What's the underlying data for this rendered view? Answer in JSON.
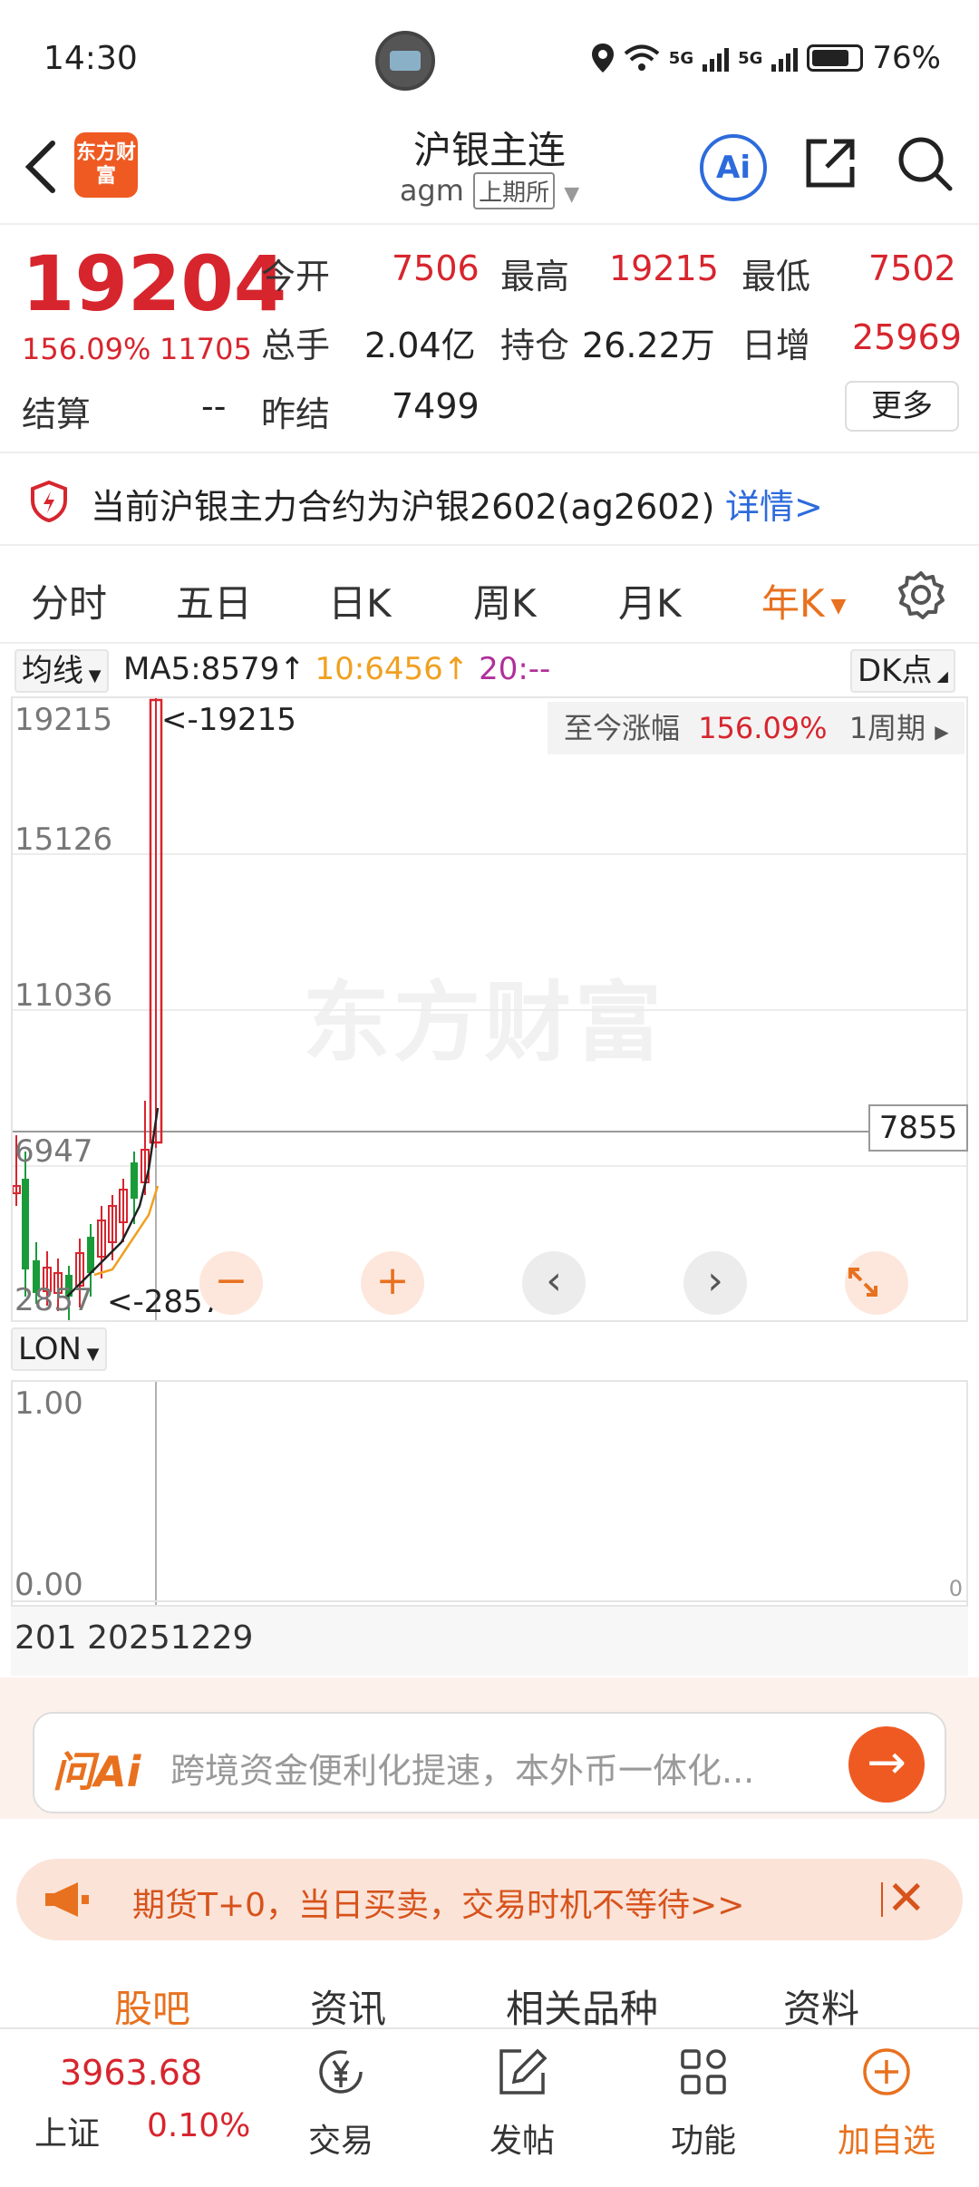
{
  "status": {
    "time": "14:30",
    "net1": "5G",
    "net2": "5G",
    "battery": "76%"
  },
  "header": {
    "logo_text": "东方财富",
    "title": "沪银主连",
    "code": "agm",
    "exchange": "上期所",
    "ai_label": "Ai"
  },
  "quote": {
    "price": "19204",
    "change_pct": "156.09%",
    "change_abs": "11705",
    "open_label": "今开",
    "open": "7506",
    "high_label": "最高",
    "high": "19215",
    "low_label": "最低",
    "low": "7502",
    "volume_label": "总手",
    "volume": "2.04亿",
    "position_label": "持仓",
    "position": "26.22万",
    "daily_inc_label": "日增",
    "daily_inc": "25969",
    "settle_label": "结算",
    "settle": "--",
    "prev_settle_label": "昨结",
    "prev_settle": "7499",
    "more_label": "更多"
  },
  "notice": {
    "text": "当前沪银主力合约为沪银2602(ag2602)",
    "link": "详情>"
  },
  "period_tabs": [
    "分时",
    "五日",
    "日K",
    "周K",
    "月K",
    "年K"
  ],
  "active_tab": "年K",
  "indicator": {
    "selector": "均线",
    "ma5": "MA5:8579↑",
    "ma10": "10:6456↑",
    "ma20": "20:--",
    "dk": "DK点"
  },
  "chart": {
    "watermark": "东方财富",
    "y_ticks": [
      "19215",
      "15126",
      "11036",
      "6947",
      "2857"
    ],
    "max_label": "<-19215",
    "min_label": "<-2857",
    "range_label": "至今涨幅",
    "range_value": "156.09%",
    "period_label": "1周期",
    "crosshair_price": "7855",
    "colors": {
      "up": "#d7252e",
      "down": "#1a9b3a",
      "ma5": "#222222",
      "ma10": "#f0a020"
    }
  },
  "sub_chart": {
    "selector": "LON",
    "y_ticks": [
      "1.00",
      "0.00"
    ],
    "right_tick": "0"
  },
  "date_bar": {
    "text": "201 20251229"
  },
  "ask_ai": {
    "logo": "问Ai",
    "placeholder": "跨境资金便利化提速，本外币一体化..."
  },
  "promo": {
    "text": "期货T+0，当日买卖，交易时机不等待>>"
  },
  "section_tabs": [
    "股吧",
    "资讯",
    "相关品种",
    "资料"
  ],
  "bottom_nav": {
    "index_value": "3963.68",
    "index_name": "上证",
    "index_pct": "0.10%",
    "items": [
      "交易",
      "发帖",
      "功能",
      "加自选"
    ]
  }
}
